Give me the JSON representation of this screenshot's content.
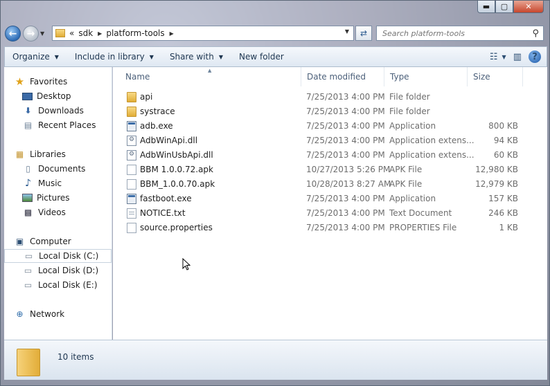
{
  "window": {
    "caption": {
      "minimize": "▬",
      "maximize": "▢",
      "close": "✕"
    }
  },
  "address": {
    "overflow": "«",
    "segments": [
      "sdk",
      "platform-tools"
    ]
  },
  "search": {
    "placeholder": "Search platform-tools"
  },
  "toolbar": {
    "organize": "Organize",
    "include": "Include in library",
    "share": "Share with",
    "newfolder": "New folder"
  },
  "nav": {
    "favorites": "Favorites",
    "desktop": "Desktop",
    "downloads": "Downloads",
    "recent": "Recent Places",
    "libraries": "Libraries",
    "documents": "Documents",
    "music": "Music",
    "pictures": "Pictures",
    "videos": "Videos",
    "computer": "Computer",
    "diskC": "Local Disk (C:)",
    "diskD": "Local Disk (D:)",
    "diskE": "Local Disk (E:)",
    "network": "Network"
  },
  "columns": {
    "name": "Name",
    "date": "Date modified",
    "type": "Type",
    "size": "Size"
  },
  "files": [
    {
      "name": "api",
      "date": "7/25/2013 4:00 PM",
      "type": "File folder",
      "size": ""
    },
    {
      "name": "systrace",
      "date": "7/25/2013 4:00 PM",
      "type": "File folder",
      "size": ""
    },
    {
      "name": "adb.exe",
      "date": "7/25/2013 4:00 PM",
      "type": "Application",
      "size": "800 KB"
    },
    {
      "name": "AdbWinApi.dll",
      "date": "7/25/2013 4:00 PM",
      "type": "Application extens...",
      "size": "94 KB"
    },
    {
      "name": "AdbWinUsbApi.dll",
      "date": "7/25/2013 4:00 PM",
      "type": "Application extens...",
      "size": "60 KB"
    },
    {
      "name": "BBM 1.0.0.72.apk",
      "date": "10/27/2013 5:26 PM",
      "type": "APK File",
      "size": "12,980 KB"
    },
    {
      "name": "BBM_1.0.0.70.apk",
      "date": "10/28/2013 8:27 AM",
      "type": "APK File",
      "size": "12,979 KB"
    },
    {
      "name": "fastboot.exe",
      "date": "7/25/2013 4:00 PM",
      "type": "Application",
      "size": "157 KB"
    },
    {
      "name": "NOTICE.txt",
      "date": "7/25/2013 4:00 PM",
      "type": "Text Document",
      "size": "246 KB"
    },
    {
      "name": "source.properties",
      "date": "7/25/2013 4:00 PM",
      "type": "PROPERTIES File",
      "size": "1 KB"
    }
  ],
  "status": {
    "count": "10 items"
  },
  "icons": {
    "cursor": "mouse-pointer"
  }
}
